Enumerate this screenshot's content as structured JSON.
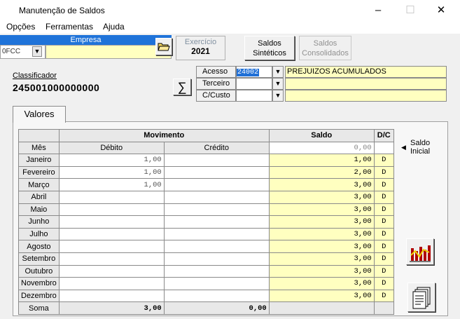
{
  "window": {
    "title": "Manutenção de Saldos",
    "min": "–",
    "max": "☐",
    "close": "✕"
  },
  "menu": [
    "Opções",
    "Ferramentas",
    "Ajuda"
  ],
  "empresa": {
    "label": "Empresa",
    "code": "0FCC",
    "name": ""
  },
  "exercicio": {
    "label": "Exercício",
    "value": "2021"
  },
  "buttons": {
    "saldos_sinteticos": [
      "Saldos",
      "Sintéticos"
    ],
    "saldos_consolidados": [
      "Saldos",
      "Consolidados"
    ]
  },
  "classificador": {
    "label": "Classificador",
    "value": "245001000000000"
  },
  "fields": {
    "acesso": {
      "label": "Acesso",
      "value": "24002",
      "desc": "PREJUIZOS ACUMULADOS"
    },
    "terceiro": {
      "label": "Terceiro",
      "value": "",
      "desc": ""
    },
    "ccusto": {
      "label": "C/Custo",
      "value": "",
      "desc": ""
    }
  },
  "tab": "Valores",
  "table": {
    "movimento": "Movimento",
    "saldo": "Saldo",
    "dc": "D/C",
    "mes": "Mês",
    "debito": "Débito",
    "credito": "Crédito",
    "saldo_inicial": "0,00",
    "rows": [
      {
        "mes": "Janeiro",
        "debito": "1,00",
        "credito": "",
        "saldo": "1,00",
        "dc": "D"
      },
      {
        "mes": "Fevereiro",
        "debito": "1,00",
        "credito": "",
        "saldo": "2,00",
        "dc": "D"
      },
      {
        "mes": "Março",
        "debito": "1,00",
        "credito": "",
        "saldo": "3,00",
        "dc": "D"
      },
      {
        "mes": "Abril",
        "debito": "",
        "credito": "",
        "saldo": "3,00",
        "dc": "D"
      },
      {
        "mes": "Maio",
        "debito": "",
        "credito": "",
        "saldo": "3,00",
        "dc": "D"
      },
      {
        "mes": "Junho",
        "debito": "",
        "credito": "",
        "saldo": "3,00",
        "dc": "D"
      },
      {
        "mes": "Julho",
        "debito": "",
        "credito": "",
        "saldo": "3,00",
        "dc": "D"
      },
      {
        "mes": "Agosto",
        "debito": "",
        "credito": "",
        "saldo": "3,00",
        "dc": "D"
      },
      {
        "mes": "Setembro",
        "debito": "",
        "credito": "",
        "saldo": "3,00",
        "dc": "D"
      },
      {
        "mes": "Outubro",
        "debito": "",
        "credito": "",
        "saldo": "3,00",
        "dc": "D"
      },
      {
        "mes": "Novembro",
        "debito": "",
        "credito": "",
        "saldo": "3,00",
        "dc": "D"
      },
      {
        "mes": "Dezembro",
        "debito": "",
        "credito": "",
        "saldo": "3,00",
        "dc": "D"
      }
    ],
    "soma": {
      "label": "Soma",
      "debito": "3,00",
      "credito": "0,00"
    }
  },
  "saldo_inicial_label": [
    "Saldo",
    "Inicial"
  ]
}
